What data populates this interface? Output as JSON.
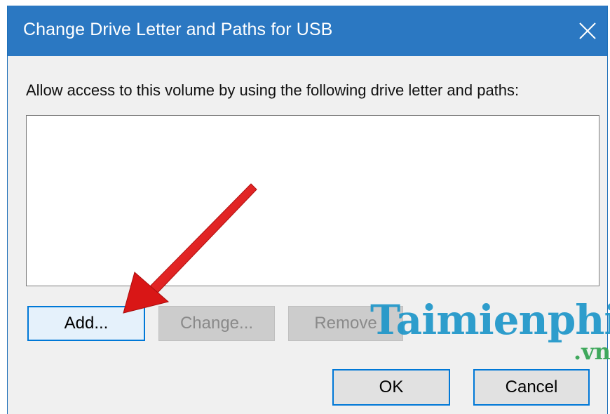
{
  "dialog": {
    "title": "Change Drive Letter and Paths for USB",
    "close_icon": "close-icon",
    "prompt": "Allow access to this volume by using the following drive letter and paths:",
    "paths_list": [],
    "buttons": {
      "add": "Add...",
      "change": "Change...",
      "remove": "Remove",
      "ok": "OK",
      "cancel": "Cancel"
    },
    "disabled_buttons": [
      "change",
      "remove"
    ]
  },
  "watermark": {
    "text": "Taimienphi",
    "suffix": ".vn"
  },
  "annotation": {
    "arrow_color": "#e01b1b",
    "points_to": "add"
  },
  "colors": {
    "titlebar": "#2b78c2",
    "dialog_bg": "#f0f0f0",
    "focus_border": "#0078d7",
    "watermark_blue": "#1a95c9",
    "watermark_green": "#3fa85c"
  }
}
